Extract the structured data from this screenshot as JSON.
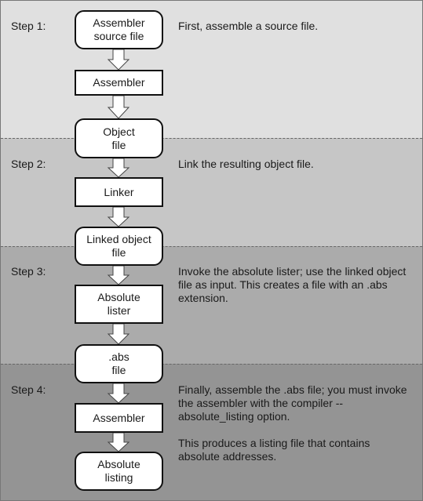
{
  "colors": {
    "band1": "#e0e0e0",
    "band2": "#c6c6c6",
    "band3": "#ababab",
    "band4": "#949494"
  },
  "steps": [
    {
      "label": "Step 1:",
      "description": [
        "First, assemble a source file."
      ]
    },
    {
      "label": "Step 2:",
      "description": [
        "Link the resulting object file."
      ]
    },
    {
      "label": "Step 3:",
      "description": [
        "Invoke the absolute lister; use the linked object file as input. This creates a file with an .abs extension."
      ]
    },
    {
      "label": "Step 4:",
      "description": [
        "Finally, assemble the .abs file; you must invoke the assembler with the compiler --absolute_listing option.",
        "This produces a listing file that contains absolute addresses."
      ]
    }
  ],
  "nodes": [
    {
      "label": "Assembler source file",
      "shape": "rounded"
    },
    {
      "label": "Assembler",
      "shape": "rect"
    },
    {
      "label": "Object file",
      "shape": "rounded"
    },
    {
      "label": "Linker",
      "shape": "rect"
    },
    {
      "label": "Linked object file",
      "shape": "rounded"
    },
    {
      "label": "Absolute lister",
      "shape": "rect"
    },
    {
      "label": ".abs file",
      "shape": "rounded"
    },
    {
      "label": "Assembler",
      "shape": "rect"
    },
    {
      "label": "Absolute listing",
      "shape": "rounded"
    }
  ]
}
